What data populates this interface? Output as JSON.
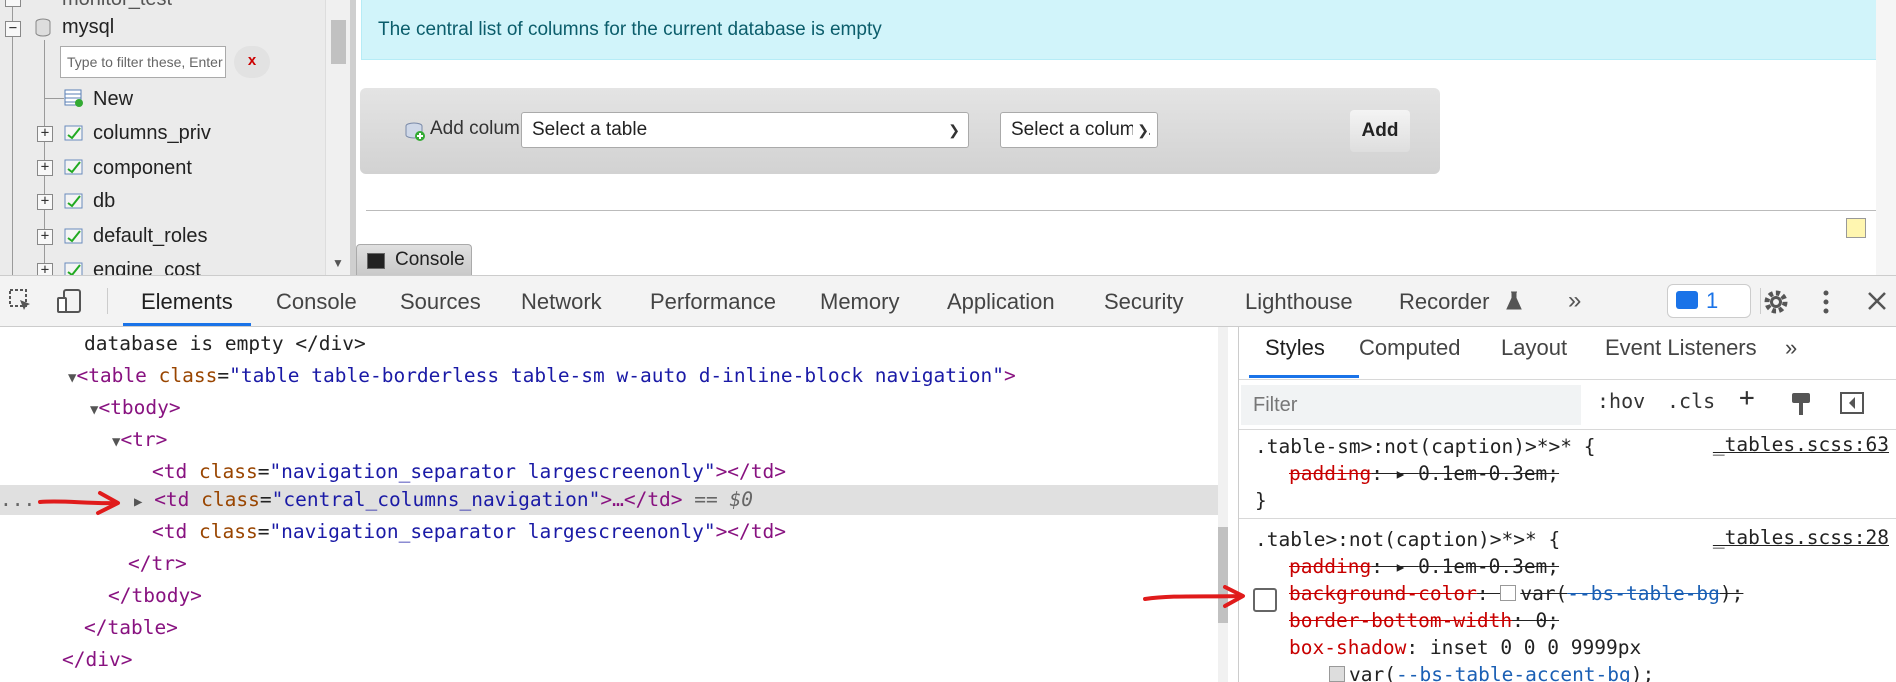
{
  "nav_tree": {
    "truncated_top_item": "monitor_test",
    "db_name": "mysql",
    "filter_placeholder": "Type to filter these, Enter",
    "filter_clear": "x",
    "items": [
      {
        "label": "New"
      },
      {
        "label": "columns_priv"
      },
      {
        "label": "component"
      },
      {
        "label": "db"
      },
      {
        "label": "default_roles"
      },
      {
        "label": "engine_cost"
      }
    ]
  },
  "main": {
    "notice": "The central list of columns for the current database is empty",
    "add_column_label": "Add column",
    "select_table": "Select a table",
    "select_column": "Select a column.",
    "add_button": "Add",
    "console_tab": "Console"
  },
  "devtools": {
    "tabs": [
      "Elements",
      "Console",
      "Sources",
      "Network",
      "Performance",
      "Memory",
      "Application",
      "Security",
      "Lighthouse",
      "Recorder"
    ],
    "active_tab": "Elements",
    "more": "»",
    "issues_count": "1",
    "accent": "#1a73e8"
  },
  "elements": {
    "line0": "database is empty </div>",
    "table_tag": "table",
    "table_class_attr": "class",
    "table_class": "\"table table-borderless table-sm w-auto d-inline-block navigation\"",
    "tbody": "<tbody>",
    "tr": "<tr>",
    "td1_open": "<td",
    "td_class_attr": "class",
    "td1_class": "\"navigation_separator largescreenonly\"",
    "td_close": "></td>",
    "sel_td_class": "\"central_columns_navigation\"",
    "sel_td_rest": ">…</td>",
    "sel_marker": "== $0",
    "td3_class": "\"navigation_separator largescreenonly\"",
    "tr_close": "</tr>",
    "tbody_close": "</tbody>",
    "table_close": "</table>",
    "div_close": "</div>",
    "gutter_dots": "..."
  },
  "styles": {
    "tabs": [
      "Styles",
      "Computed",
      "Layout",
      "Event Listeners"
    ],
    "more": "»",
    "filter_placeholder": "Filter",
    "hov": ":hov",
    "cls": ".cls",
    "plus": "+",
    "rule1": {
      "selector": ".table-sm>:not(caption)>*>* {",
      "source": "_tables.scss:63",
      "prop": "padding",
      "value": "0.1em-0.3em;",
      "close": "}"
    },
    "rule2": {
      "selector": ".table>:not(caption)>*>* {",
      "source": "_tables.scss:28",
      "p1_name": "padding",
      "p1_value": "0.1em-0.3em;",
      "p2_name": "background-color",
      "p2_value_pre": "var(",
      "p2_value_var": "--bs-table-bg",
      "p2_value_post": ");",
      "p3_name": "border-bottom-width",
      "p3_value": "0;",
      "p4_name": "box-shadow",
      "p4_value": "inset 0 0 0 9999px",
      "p5_value_pre": "var(",
      "p5_value_var": "--bs-table-accent-bg",
      "p5_value_post": ");"
    }
  },
  "colors": {
    "annotation_red": "#e01b1b",
    "notice_bg": "#d1f4fa"
  }
}
